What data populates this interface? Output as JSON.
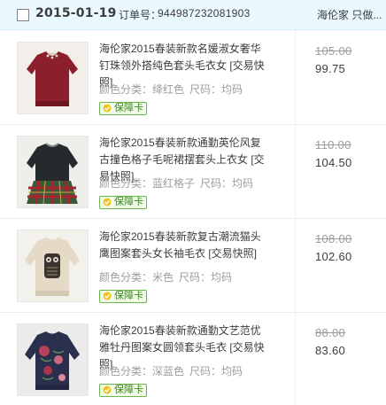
{
  "order": {
    "date": "2015-01-19",
    "order_no_label": "订单号：",
    "order_no": "944987232081903",
    "shop": "海伦家 只做..."
  },
  "badge_label": "保障卡",
  "items": [
    {
      "title": "海伦家2015春装新款名媛淑女奢华钉珠领外搭纯色套头毛衣女 [交易快照]",
      "attrs_label": "颜色分类：",
      "color": "绛红色",
      "size_label": "尺码：",
      "size": "均码",
      "price_original": "105.00",
      "price_current": "99.75",
      "thumb_color": "#8b1f2b"
    },
    {
      "title": "海伦家2015春装新款通勤英伦风复古撞色格子毛呢裙摆套头上衣女 [交易快照]",
      "attrs_label": "颜色分类：",
      "color": "蓝红格子",
      "size_label": "尺码：",
      "size": "均码",
      "price_original": "110.00",
      "price_current": "104.50",
      "thumb_color": "#3b4a3f"
    },
    {
      "title": "海伦家2015春装新款复古潮流猫头鹰图案套头女长袖毛衣 [交易快照]",
      "attrs_label": "颜色分类：",
      "color": "米色",
      "size_label": "尺码：",
      "size": "均码",
      "price_original": "108.00",
      "price_current": "102.60",
      "thumb_color": "#e8dfcf"
    },
    {
      "title": "海伦家2015春装新款通勤文艺范优雅牡丹图案女圆领套头毛衣 [交易快照]",
      "attrs_label": "颜色分类：",
      "color": "深蓝色",
      "size_label": "尺码：",
      "size": "均码",
      "price_original": "88.00",
      "price_current": "83.60",
      "thumb_color": "#2a2f4d"
    }
  ]
}
